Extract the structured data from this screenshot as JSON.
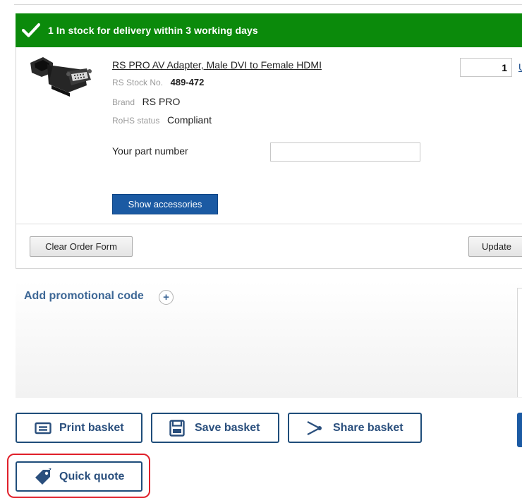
{
  "stock_banner": {
    "text": "1 In stock for delivery within 3 working days",
    "icon": "check-icon",
    "color": "#0b8a0b"
  },
  "product": {
    "title": "RS PRO AV Adapter, Male DVI to Female HDMI",
    "stock_no_label": "RS Stock No.",
    "stock_no": "489-472",
    "brand_label": "Brand",
    "brand": "RS PRO",
    "rohs_label": "RoHS status",
    "rohs": "Compliant",
    "part_number_label": "Your part number",
    "part_number_value": "",
    "quantity": "1",
    "unit_link": "U",
    "show_accessories_label": "Show accessories"
  },
  "order_form": {
    "clear_label": "Clear Order Form",
    "update_label": "Update"
  },
  "promo": {
    "label": "Add promotional code",
    "plus_symbol": "+"
  },
  "actions": {
    "print_label": "Print basket",
    "save_label": "Save basket",
    "share_label": "Share basket",
    "quote_label": "Quick quote"
  },
  "colors": {
    "accent_blue": "#1b5aa3",
    "outline_navy": "#1f4d7a",
    "highlight_red": "#e0202a"
  }
}
